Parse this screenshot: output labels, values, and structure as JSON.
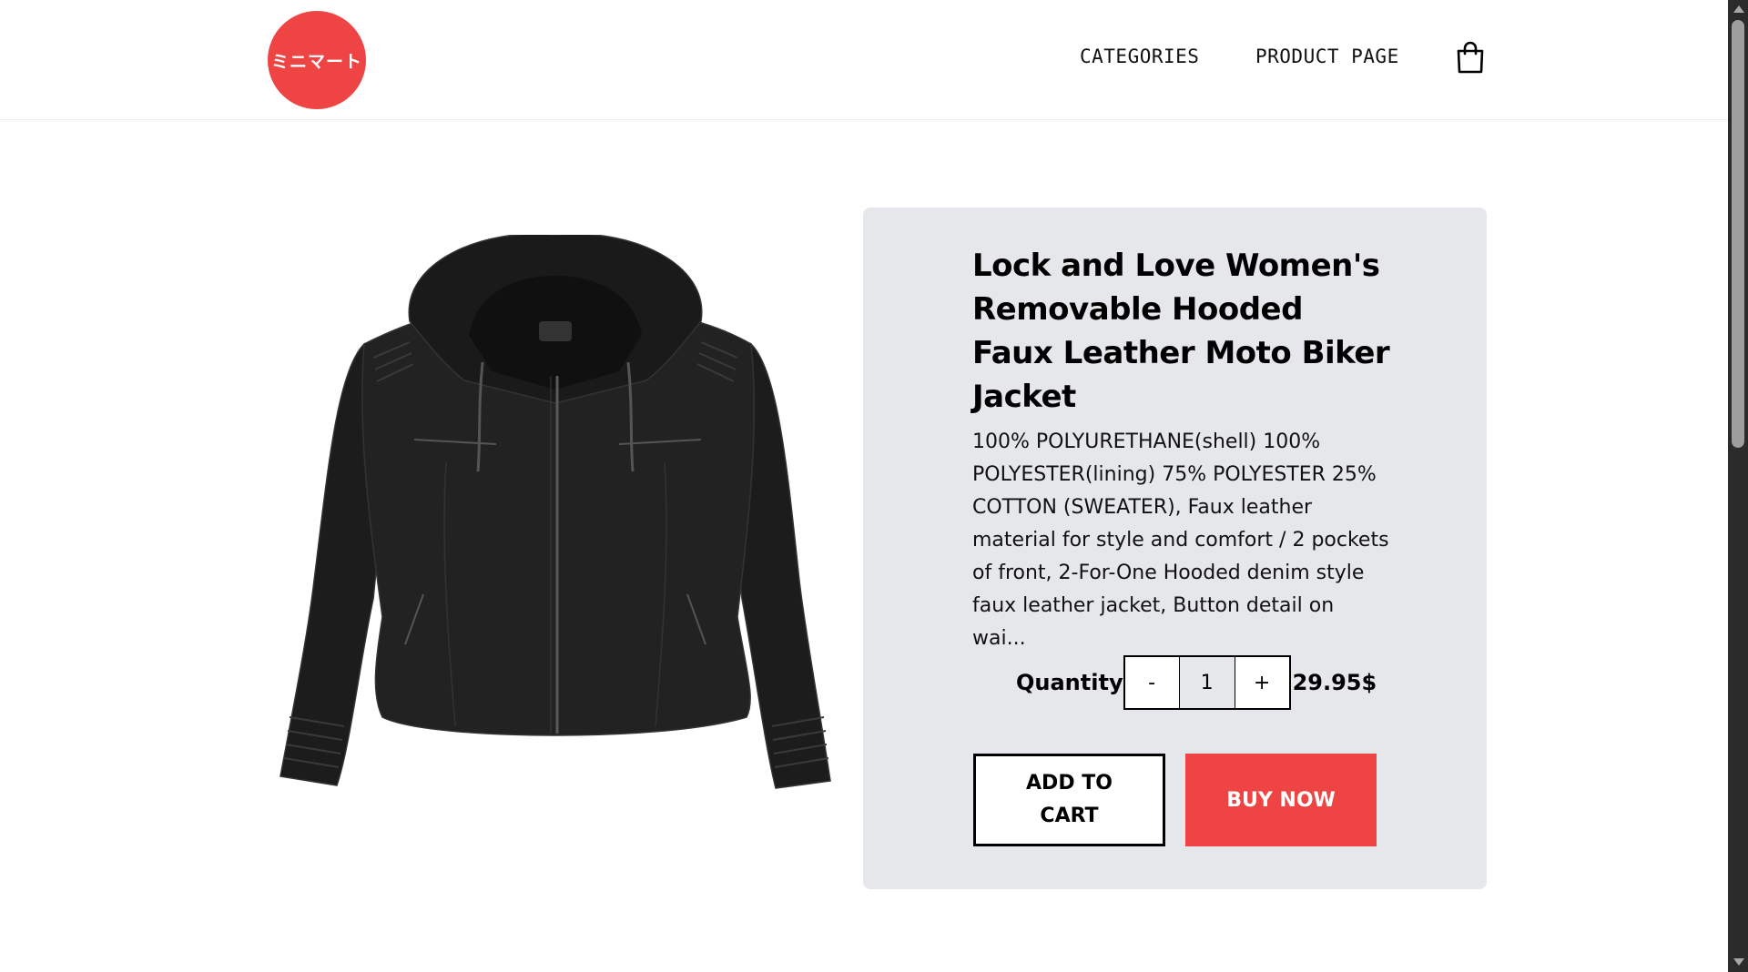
{
  "header": {
    "logo_text": "ミニマート",
    "nav": [
      {
        "label": "CATEGORIES"
      },
      {
        "label": "PRODUCT PAGE"
      }
    ],
    "cart_icon": "shopping-bag-icon"
  },
  "product": {
    "image_alt": "jacket-image",
    "title": "Lock and Love Women's Removable Hooded Faux Leather Moto Biker Jacket",
    "description": "100% POLYURETHANE(shell) 100% POLYESTER(lining) 75% POLYESTER 25% COTTON (SWEATER), Faux leather material for style and comfort / 2 pockets of front, 2-For-One Hooded denim style faux leather jacket, Button detail on wai...",
    "quantity_label": "Quantity",
    "decrement_label": "-",
    "quantity_value": "1",
    "increment_label": "+",
    "price": "29.95$",
    "add_to_cart_label": "ADD TO CART",
    "buy_now_label": "BUY NOW"
  },
  "colors": {
    "brand": "#ef4444",
    "panel_bg": "#e5e7eb"
  }
}
